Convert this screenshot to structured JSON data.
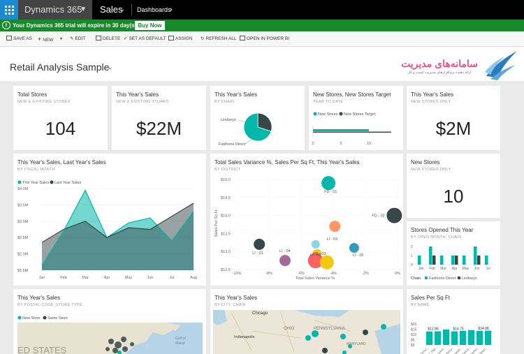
{
  "topbar": {
    "app": "Dynamics 365",
    "area": "Sales",
    "crumb": "Dashboards"
  },
  "trial": {
    "text": "Your Dynamics 365 trial will expire in 30 day(s)",
    "button": "Buy Now"
  },
  "toolbar": {
    "save_as": "SAVE AS",
    "new": "NEW",
    "edit": "EDIT",
    "delete": "DELETE",
    "set_default": "SET AS DEFAULT",
    "assign": "ASSIGN",
    "refresh": "REFRESH ALL",
    "open_pbi": "OPEN IN POWER BI"
  },
  "dashboard": {
    "title": "Retail Analysis Sample"
  },
  "logo": {
    "text": "سامانه‌های مدیریت",
    "sub": "ارائه دهنده نرم‌افزارهای مدیریت کسب و کار"
  },
  "colors": {
    "teal": "#01b8aa",
    "dark": "#374649",
    "orange": "#fd625e",
    "green": "#198a2c"
  },
  "tiles": {
    "total_stores": {
      "title": "Total Stores",
      "sub": "NEW & EXISTING STORES",
      "value": "104"
    },
    "this_year_sales": {
      "title": "This Year's Sales",
      "sub": "NEW & EXISTING STORES",
      "value": "$22M"
    },
    "sales_by_chain": {
      "title": "This Year's Sales",
      "sub": "BY CHAIN",
      "labels": [
        "Lindseys",
        "Fashions Direct"
      ]
    },
    "new_stores_target": {
      "title": "New Stores, New Stores Target",
      "sub": "YEAR TO DATE",
      "legend": [
        "New Stores",
        "New Stores Target"
      ],
      "ticks": [
        "0",
        "5",
        "10"
      ]
    },
    "this_year_new": {
      "title": "This Year's Sales",
      "sub": "NEW STORES ONLY",
      "value": "$2M"
    },
    "new_stores": {
      "title": "New Stores",
      "sub": "NEW STORES ONLY",
      "value": "10"
    },
    "sales_line": {
      "title": "This Year's Sales, Last Year's Sales",
      "sub": "BY FISCAL MONTH",
      "legend": [
        "This Year Sales",
        "Last Year Sales"
      ]
    },
    "scatter": {
      "title": "Total Sales Variance %, Sales Per Sq Ft, This Year's Sales",
      "sub": "BY DISTRICT",
      "xlabel": "Total Sales Variance %",
      "ylabel": "Sales Per Sq Ft"
    },
    "stores_opened": {
      "title": "Stores Opened This Year",
      "sub": "BY OPEN MONTH, CHAIN",
      "legend_title": "Chain",
      "legend": [
        "Fashions Direct",
        "Lindseys"
      ]
    },
    "map_postal": {
      "title": "This Year's Sales",
      "sub": "BY POSTAL CODE, STORE TYPE",
      "legend": [
        "New Store",
        "Same Store"
      ],
      "map_labels": [
        "Gulf of",
        "Maine",
        "ED STATES"
      ]
    },
    "map_city": {
      "title": "This Year's Sales",
      "sub": "BY CITY, CHAIN",
      "map_labels": [
        "Chicago",
        "OHIO",
        "PENNSYLVANIA",
        "Indianapolis",
        "MARYLAND"
      ]
    },
    "sales_sqft": {
      "title": "Sales Per Sq Ft",
      "sub": "BY NAME"
    }
  },
  "chart_data": [
    {
      "type": "pie",
      "title": "This Year's Sales",
      "categories": [
        "Lindseys",
        "Fashions Direct"
      ],
      "values": [
        30,
        70
      ]
    },
    {
      "type": "bar",
      "title": "New Stores, New Stores Target",
      "categories": [
        "Year to date"
      ],
      "series": [
        {
          "name": "New Stores",
          "values": [
            10
          ]
        },
        {
          "name": "New Stores Target",
          "values": [
            14
          ]
        }
      ],
      "xlim": [
        0,
        15
      ]
    },
    {
      "type": "area",
      "title": "This Year's Sales, Last Year's Sales",
      "categories": [
        "Jan",
        "Feb",
        "Mar",
        "Apr",
        "May",
        "Jun",
        "Jul",
        "Aug"
      ],
      "series": [
        {
          "name": "This Year Sales",
          "values": [
            1.65,
            2.7,
            3.95,
            2.5,
            2.95,
            3.1,
            2.4,
            3.3
          ]
        },
        {
          "name": "Last Year Sales",
          "values": [
            2.35,
            2.75,
            3.0,
            2.5,
            2.8,
            2.75,
            3.15,
            3.55
          ]
        }
      ],
      "yticks": [
        "$4.0M",
        "$3.5M",
        "$3.0M",
        "$2.5M",
        "$2.0M",
        "$1.5M"
      ],
      "ylim": [
        1.5,
        4.0
      ]
    },
    {
      "type": "scatter",
      "title": "Total Sales Variance %, Sales Per Sq Ft, This Year's Sales",
      "xlabel": "Total Sales Variance %",
      "ylabel": "Sales Per Sq Ft",
      "xlim": [
        -10,
        0
      ],
      "ylim": [
        12.5,
        15.0
      ],
      "xticks": [
        "-10%",
        "-8%",
        "-6%",
        "-4%",
        "-2%",
        "0%"
      ],
      "yticks": [
        "$15.0",
        "$14.5",
        "$14.0",
        "$13.5",
        "$13.0",
        "$12.5"
      ],
      "points": [
        {
          "label": "FD - 01",
          "x": -4.3,
          "y": 14.9,
          "r": 10,
          "color": "#01b8aa"
        },
        {
          "label": "FD - 02",
          "x": -0.2,
          "y": 14.0,
          "r": 11,
          "color": "#374649"
        },
        {
          "label": "LI - 01",
          "x": -8.6,
          "y": 13.2,
          "r": 8,
          "color": "#374649"
        },
        {
          "label": "",
          "x": -3.9,
          "y": 13.7,
          "r": 8,
          "color": "#fe9666"
        },
        {
          "label": "LI - 03",
          "x": -5.1,
          "y": 13.2,
          "r": 6,
          "color": "#8ad4eb"
        },
        {
          "label": "LI - 05",
          "x": -2.7,
          "y": 13.1,
          "r": 7,
          "color": "#3599b8"
        },
        {
          "label": "LI - 04",
          "x": -7.0,
          "y": 12.75,
          "r": 8,
          "color": "#a66999"
        },
        {
          "label": "FD - 03",
          "x": -5.0,
          "y": 12.95,
          "r": 6,
          "color": "#f2c80f"
        },
        {
          "label": "LI - 02",
          "x": -5.1,
          "y": 12.75,
          "r": 11,
          "color": "#fd625e"
        },
        {
          "label": "",
          "x": -4.4,
          "y": 12.7,
          "r": 10,
          "color": "#f2c80f"
        }
      ]
    },
    {
      "type": "bar",
      "title": "Stores Opened This Year",
      "categories": [
        "Jan",
        "Feb",
        "Mar",
        "Apr",
        "May",
        "Jun",
        "Jul"
      ],
      "series": [
        {
          "name": "Fashions Direct",
          "values": [
            1,
            2,
            1,
            1,
            1,
            2,
            1
          ]
        },
        {
          "name": "Lindseys",
          "values": [
            0,
            1,
            0,
            1,
            0,
            1,
            0
          ]
        }
      ],
      "ylim": [
        0,
        2
      ]
    },
    {
      "type": "bar",
      "title": "Sales Per Sq Ft",
      "categories": [
        "Cincin...",
        "Ft. Ogl...",
        "Knoxvil...",
        "Monro...",
        "Pasade...",
        "Sharon...",
        "Washin...",
        "Wilson..."
      ],
      "values": [
        12.86,
        13.0,
        14.75,
        13.0,
        13.5,
        14.2,
        13.5,
        13.6
      ],
      "data_labels": [
        "$12.86",
        "$14.75",
        "$14.08"
      ],
      "yticks": [
        "$20",
        "$15",
        "$10",
        "$5",
        "$0"
      ],
      "ylim": [
        0,
        20
      ]
    }
  ]
}
